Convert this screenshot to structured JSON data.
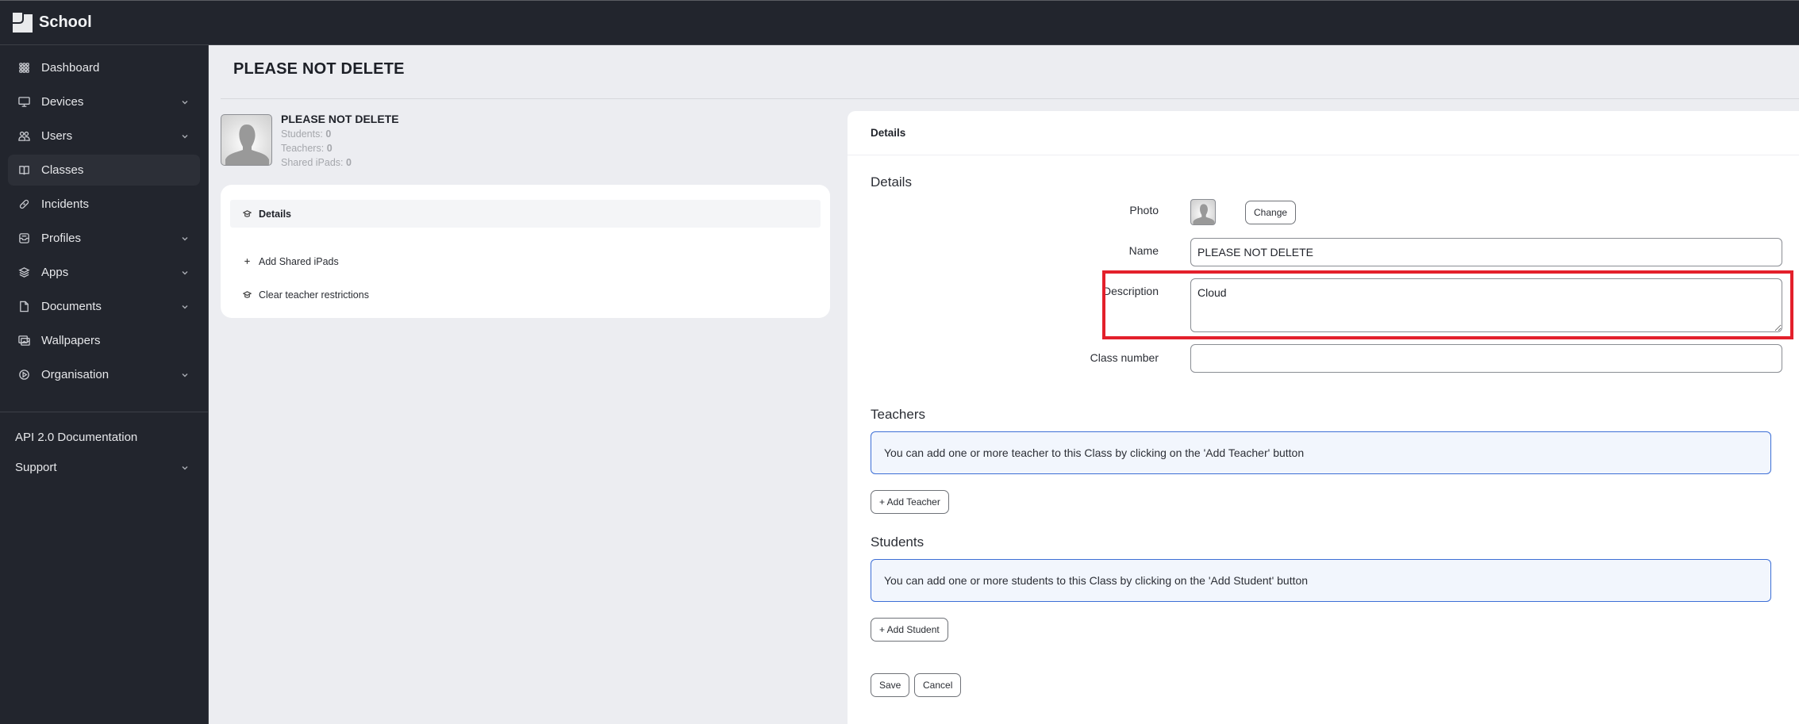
{
  "app": {
    "brand_name": "School",
    "brand_logo_icon": "school-logo-icon"
  },
  "sidebar": {
    "items": [
      {
        "label": "Dashboard",
        "icon": "grid-icon",
        "has_chevron": false,
        "active": false
      },
      {
        "label": "Devices",
        "icon": "monitor-icon",
        "has_chevron": true,
        "active": false
      },
      {
        "label": "Users",
        "icon": "users-icon",
        "has_chevron": true,
        "active": false
      },
      {
        "label": "Classes",
        "icon": "book-icon",
        "has_chevron": false,
        "active": true
      },
      {
        "label": "Incidents",
        "icon": "bandage-icon",
        "has_chevron": false,
        "active": false
      },
      {
        "label": "Profiles",
        "icon": "inbox-icon",
        "has_chevron": true,
        "active": false
      },
      {
        "label": "Apps",
        "icon": "layers-icon",
        "has_chevron": true,
        "active": false
      },
      {
        "label": "Documents",
        "icon": "document-icon",
        "has_chevron": true,
        "active": false
      },
      {
        "label": "Wallpapers",
        "icon": "images-icon",
        "has_chevron": false,
        "active": false
      },
      {
        "label": "Organisation",
        "icon": "organisation-icon",
        "has_chevron": true,
        "active": false
      }
    ],
    "footer_links": [
      {
        "label": "API 2.0 Documentation",
        "has_chevron": false
      },
      {
        "label": "Support",
        "has_chevron": true
      }
    ]
  },
  "page": {
    "title": "PLEASE NOT DELETE"
  },
  "summary": {
    "name": "PLEASE NOT DELETE",
    "stats": [
      {
        "label": "Students:",
        "value": "0"
      },
      {
        "label": "Teachers:",
        "value": "0"
      },
      {
        "label": "Shared iPads:",
        "value": "0"
      }
    ]
  },
  "left_menu": {
    "items": [
      {
        "label": "Details",
        "icon": "graduation-cap-icon",
        "selected": true
      },
      {
        "label": "Add Shared iPads",
        "icon": "plus-icon",
        "selected": false
      },
      {
        "label": "Clear teacher restrictions",
        "icon": "graduation-cap-icon",
        "selected": false
      }
    ]
  },
  "details_panel": {
    "header": "Details",
    "section_title": "Details",
    "photo_label": "Photo",
    "change_button": "Change",
    "name_label": "Name",
    "name_value": "PLEASE NOT DELETE",
    "description_label": "Description",
    "description_value": "Cloud",
    "class_number_label": "Class number",
    "class_number_value": "",
    "teachers": {
      "title": "Teachers",
      "info": "You can add one or more teacher to this Class by clicking on the 'Add Teacher' button",
      "add_button": "+ Add Teacher"
    },
    "students": {
      "title": "Students",
      "info": "You can add one or more students to this Class by clicking on the 'Add Student' button",
      "add_button": "+ Add Student"
    },
    "save_button": "Save",
    "cancel_button": "Cancel"
  },
  "colors": {
    "sidebar_bg": "#22252d",
    "page_bg": "#ecedf1",
    "accent_blue": "#3d6fd6",
    "highlight_red": "#e3202b"
  }
}
